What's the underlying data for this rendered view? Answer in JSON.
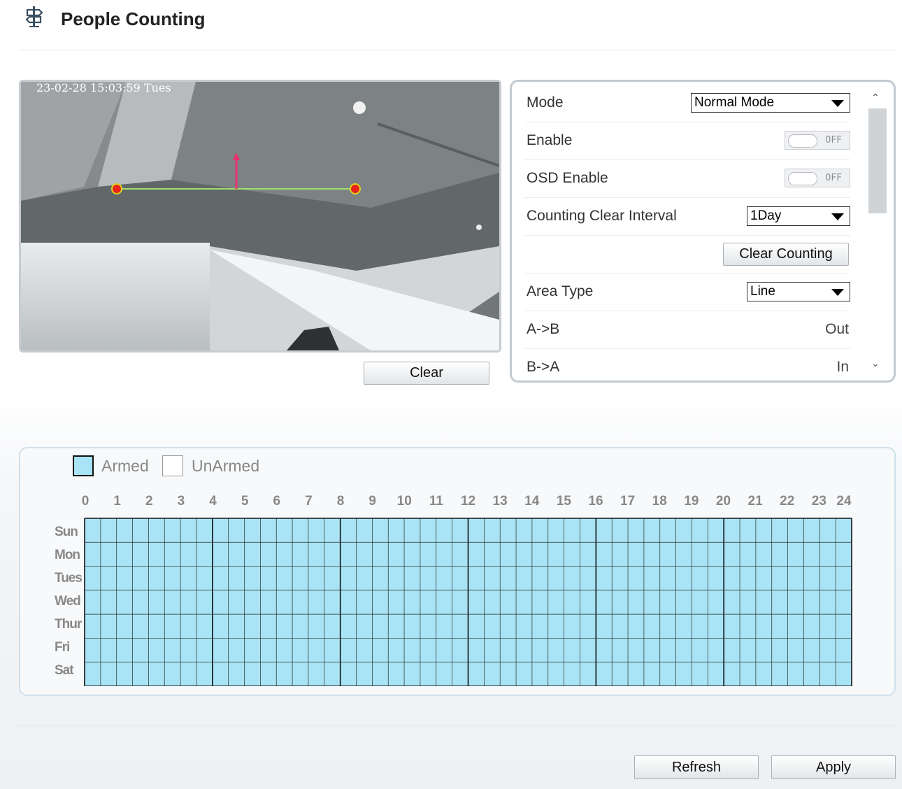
{
  "page": {
    "title": "People Counting",
    "icon": "signpost-icon"
  },
  "video": {
    "timestamp": "23-02-28 15:03:59 Tues",
    "clear_label": "Clear"
  },
  "settings": {
    "mode": {
      "label": "Mode",
      "value": "Normal Mode"
    },
    "enable": {
      "label": "Enable",
      "state": "OFF"
    },
    "osd_enable": {
      "label": "OSD Enable",
      "state": "OFF"
    },
    "clear_interval": {
      "label": "Counting Clear Interval",
      "value": "1Day"
    },
    "clear_counting_label": "Clear Counting",
    "area_type": {
      "label": "Area Type",
      "value": "Line"
    },
    "a_to_b": {
      "label": "A->B",
      "value": "Out"
    },
    "b_to_a": {
      "label": "B->A",
      "value": "In"
    }
  },
  "schedule": {
    "legend": {
      "armed": "Armed",
      "unarmed": "UnArmed"
    },
    "hours": [
      "0",
      "1",
      "2",
      "3",
      "4",
      "5",
      "6",
      "7",
      "8",
      "9",
      "10",
      "11",
      "12",
      "13",
      "14",
      "15",
      "16",
      "17",
      "18",
      "19",
      "20",
      "21",
      "22",
      "23",
      "24"
    ],
    "days": [
      "Sun",
      "Mon",
      "Tues",
      "Wed",
      "Thur",
      "Fri",
      "Sat"
    ],
    "armed_color": "#a8e4f5",
    "state": "all-armed"
  },
  "footer": {
    "refresh_label": "Refresh",
    "apply_label": "Apply"
  }
}
